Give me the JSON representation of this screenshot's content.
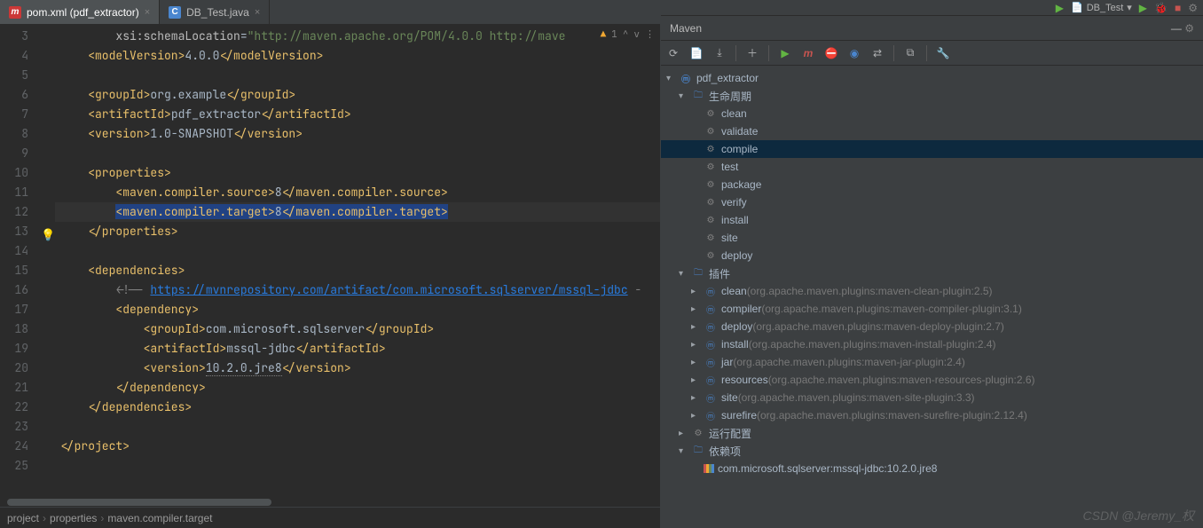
{
  "top": {
    "run_config": "DB_Test"
  },
  "tabs": [
    {
      "label": "pom.xml (pdf_extractor)",
      "active": true,
      "icon": "m"
    },
    {
      "label": "DB_Test.java",
      "active": false,
      "icon": "c"
    }
  ],
  "gutter": [
    "3",
    "4",
    "5",
    "6",
    "7",
    "8",
    "9",
    "10",
    "11",
    "12",
    "13",
    "14",
    "15",
    "16",
    "17",
    "18",
    "19",
    "20",
    "21",
    "22",
    "23",
    "24",
    "25"
  ],
  "tr_info": {
    "warn": "1",
    "caret_up": "^",
    "caret_down": "v"
  },
  "code": {
    "schema_attr": "xsi:schemaLocation",
    "schema_val": "\"http://maven.apache.org/POM/4.0.0 http://mave",
    "modelVersion": "4.0.0",
    "groupId": "org.example",
    "artifactId": "pdf_extractor",
    "version": "1.0-SNAPSHOT",
    "src": "8",
    "tgt": "8",
    "repo_link": "https://mvnrepository.com/artifact/com.microsoft.sqlserver/mssql-jdbc",
    "dep_group": "com.microsoft.sqlserver",
    "dep_artifact": "mssql-jdbc",
    "dep_version": "10.2.0.jre8"
  },
  "breadcrumb": [
    "project",
    "properties",
    "maven.compiler.target"
  ],
  "maven": {
    "title": "Maven",
    "project": "pdf_extractor",
    "lifecycle_label": "生命周期",
    "lifecycle": [
      "clean",
      "validate",
      "compile",
      "test",
      "package",
      "verify",
      "install",
      "site",
      "deploy"
    ],
    "lifecycle_selected": "compile",
    "plugins_label": "插件",
    "plugins": [
      {
        "name": "clean",
        "hint": "(org.apache.maven.plugins:maven-clean-plugin:2.5)"
      },
      {
        "name": "compiler",
        "hint": "(org.apache.maven.plugins:maven-compiler-plugin:3.1)"
      },
      {
        "name": "deploy",
        "hint": "(org.apache.maven.plugins:maven-deploy-plugin:2.7)"
      },
      {
        "name": "install",
        "hint": "(org.apache.maven.plugins:maven-install-plugin:2.4)"
      },
      {
        "name": "jar",
        "hint": "(org.apache.maven.plugins:maven-jar-plugin:2.4)"
      },
      {
        "name": "resources",
        "hint": "(org.apache.maven.plugins:maven-resources-plugin:2.6)"
      },
      {
        "name": "site",
        "hint": "(org.apache.maven.plugins:maven-site-plugin:3.3)"
      },
      {
        "name": "surefire",
        "hint": "(org.apache.maven.plugins:maven-surefire-plugin:2.12.4)"
      }
    ],
    "run_configs_label": "运行配置",
    "deps_label": "依赖项",
    "dependency": "com.microsoft.sqlserver:mssql-jdbc:10.2.0.jre8"
  },
  "watermark": "CSDN @Jeremy_权"
}
